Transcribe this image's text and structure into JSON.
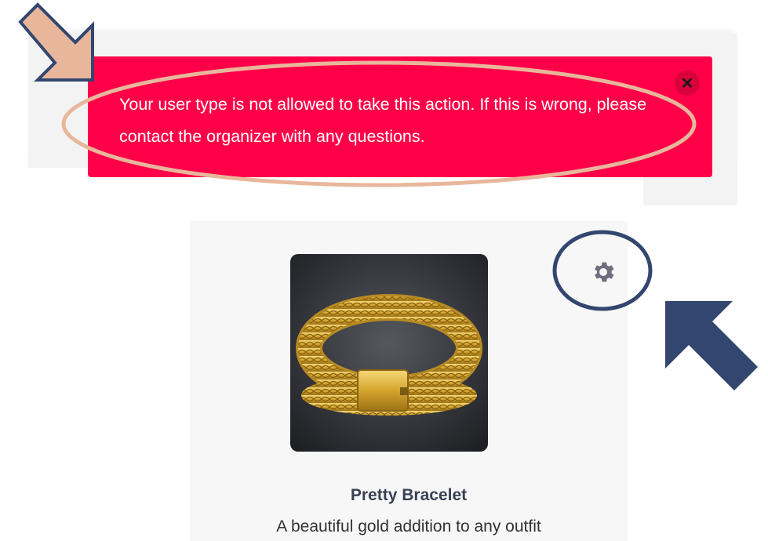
{
  "alert": {
    "message": "Your user type is not allowed to take this action. If this is wrong, please contact the organizer with any questions.",
    "close_icon": "close-icon",
    "color": "#ff0048"
  },
  "product": {
    "title": "Pretty Bracelet",
    "description": "A beautiful gold addition to any outfit",
    "image_subject": "gold chain bracelet"
  },
  "settings": {
    "icon": "gear-icon",
    "color": "#6f6d80"
  },
  "annotations": {
    "arrow_top_color": "#e8b79b",
    "ellipse_color": "#e8b79b",
    "arrow_right_color": "#33466f",
    "circle_color": "#33466f"
  }
}
